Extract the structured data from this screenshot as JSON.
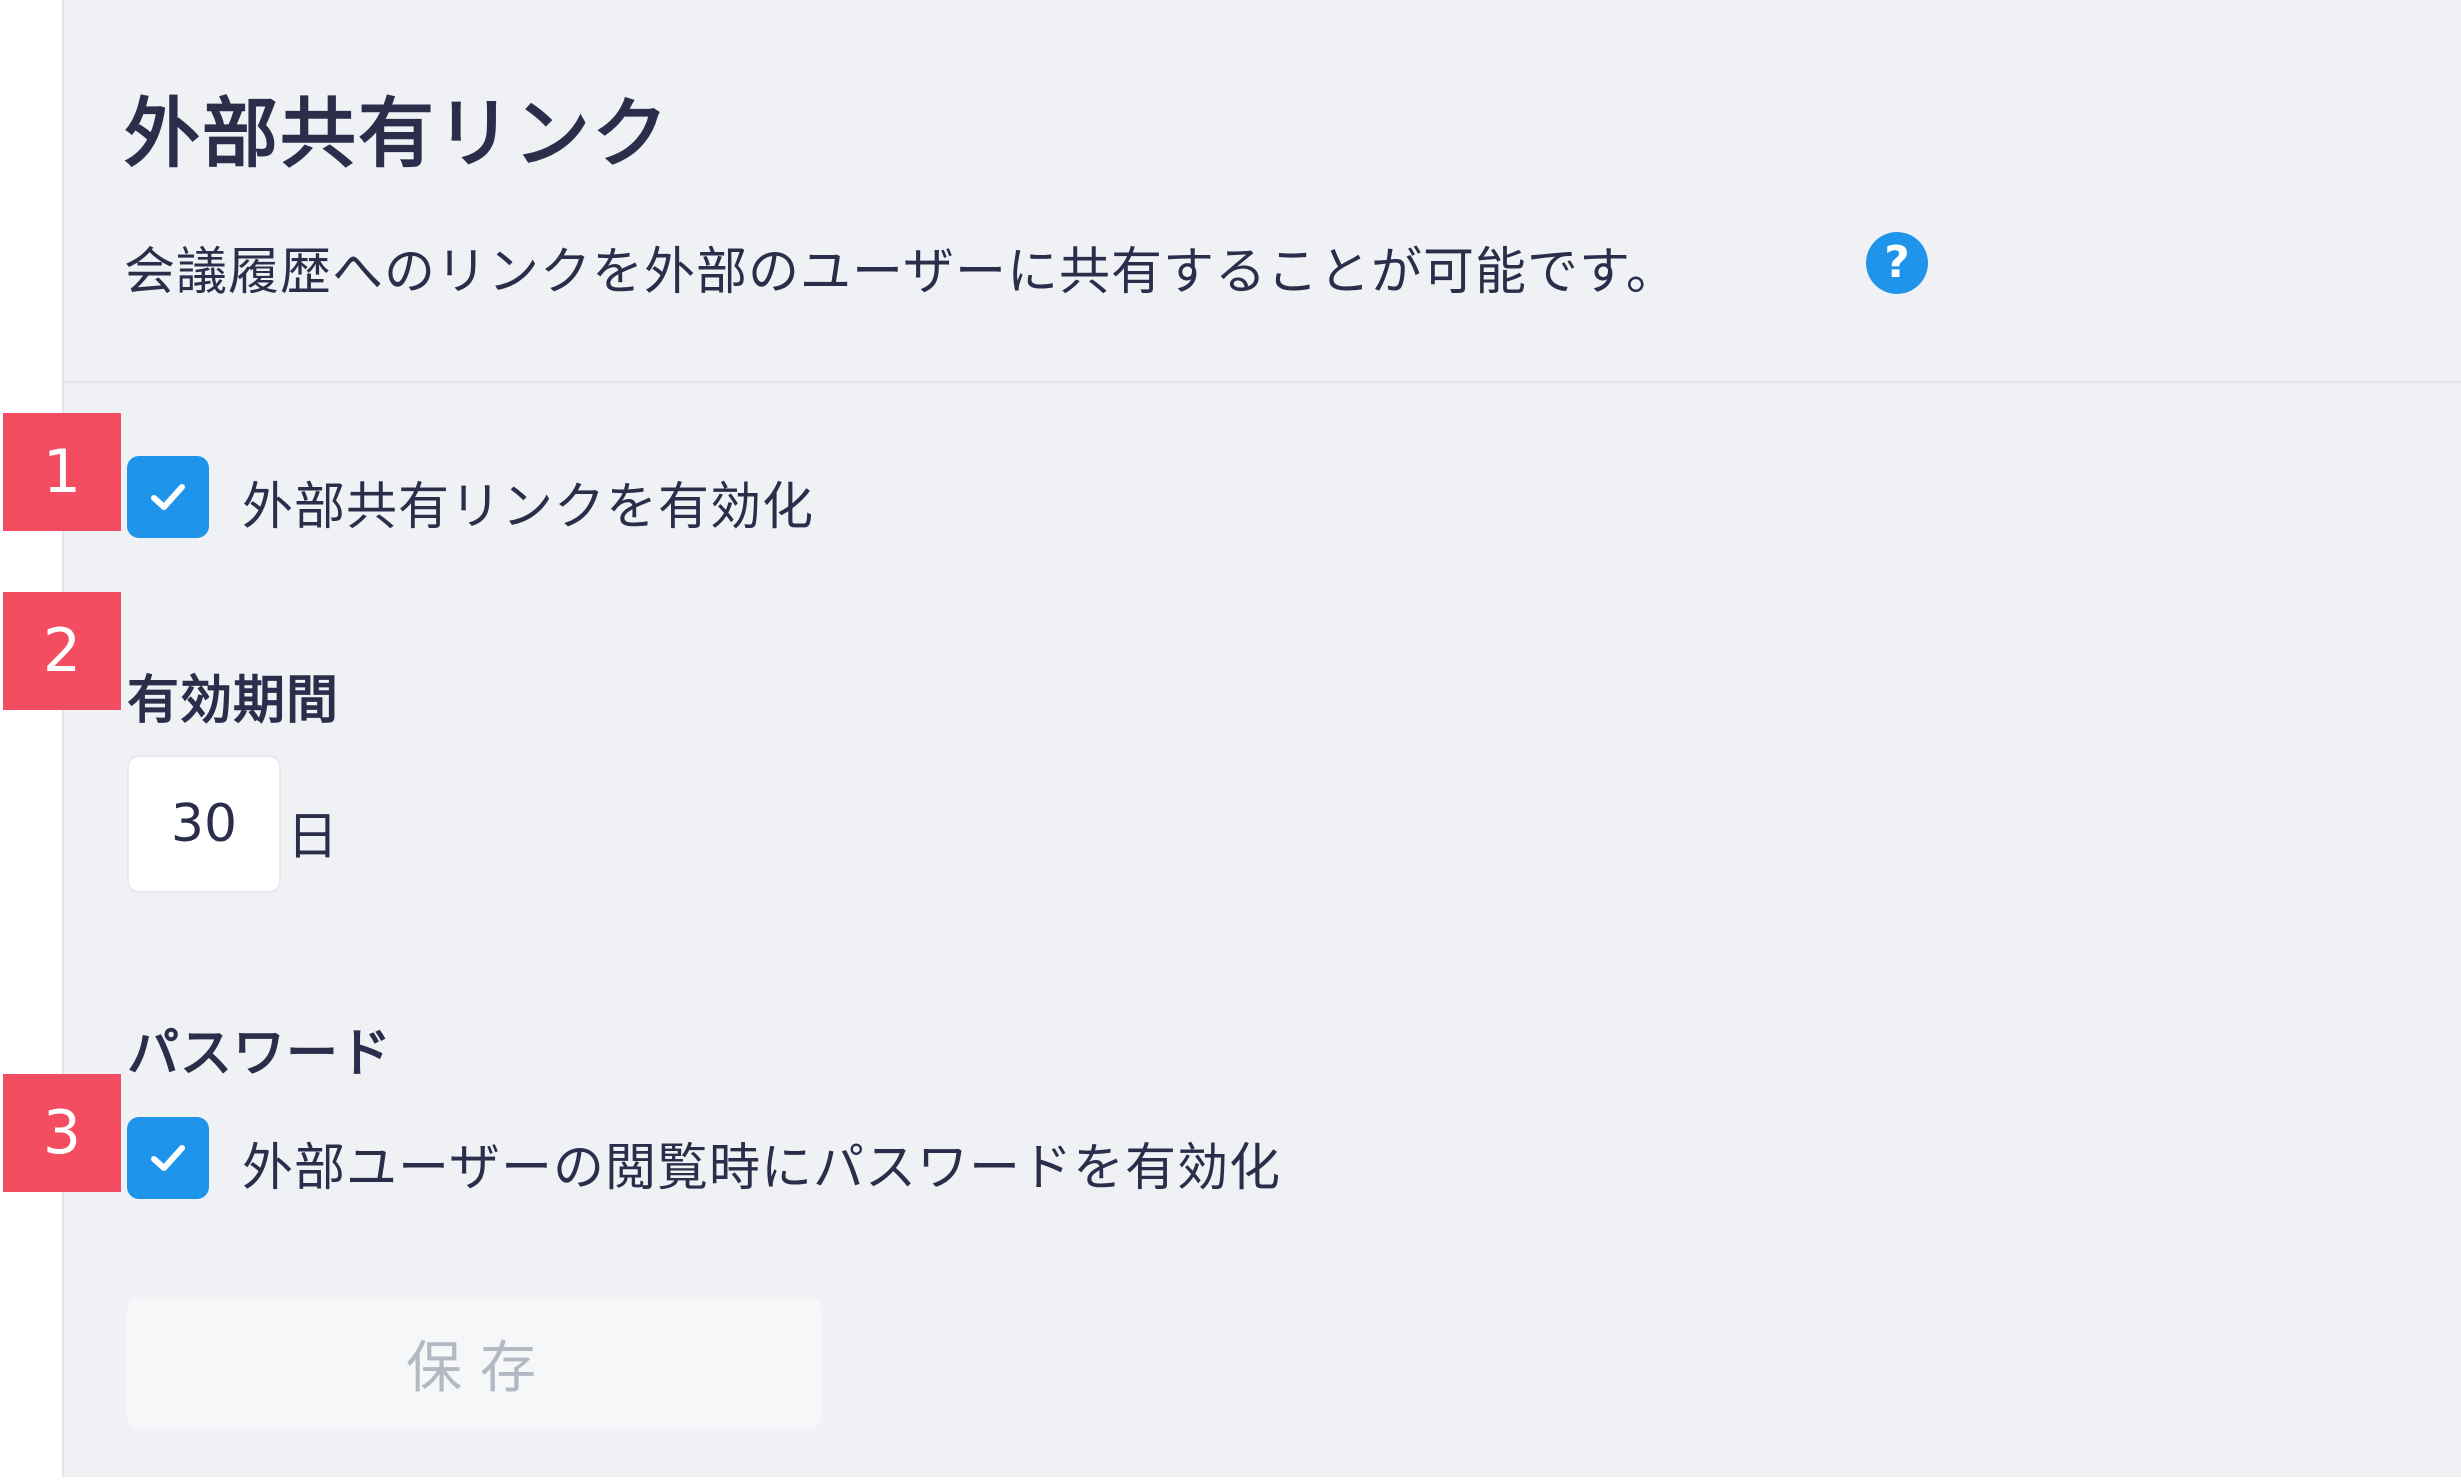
{
  "header": {
    "title": "外部共有リンク",
    "description": "会議履歴へのリンクを外部のユーザーに共有することが可能です。",
    "help_icon": "question-circle-icon"
  },
  "markers": [
    "1",
    "2",
    "3"
  ],
  "enable_link": {
    "label": "外部共有リンクを有効化",
    "checked": true
  },
  "expiry": {
    "heading": "有効期間",
    "value": "30",
    "unit": "日"
  },
  "password": {
    "heading": "パスワード",
    "label": "外部ユーザーの閲覧時にパスワードを有効化",
    "checked": true
  },
  "save": {
    "label": "保存"
  },
  "colors": {
    "accent": "#1e94ea",
    "marker": "#f44c61",
    "text": "#2b2e4a",
    "panel_bg": "#f0f1f5",
    "disabled_text": "#b4b8c3"
  }
}
